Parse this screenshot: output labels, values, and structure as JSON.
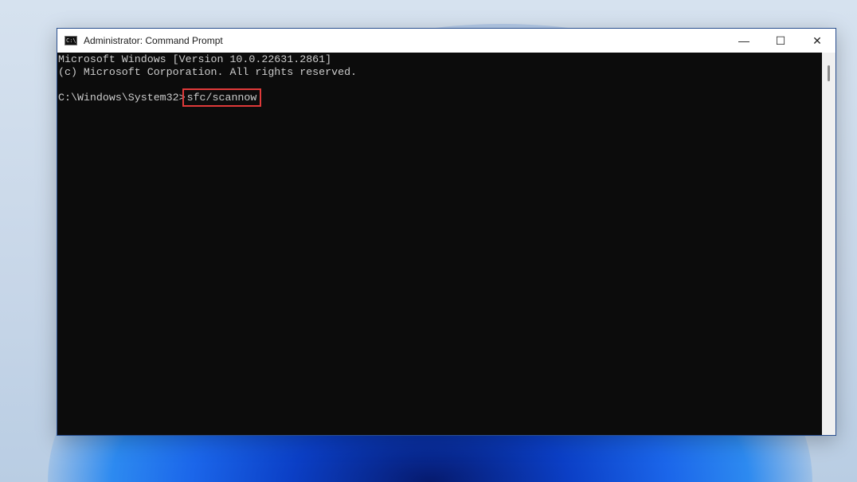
{
  "window": {
    "title": "Administrator: Command Prompt",
    "icon_text": "C:\\."
  },
  "terminal": {
    "lines": [
      "Microsoft Windows [Version 10.0.22631.2861]",
      "(c) Microsoft Corporation. All rights reserved.",
      ""
    ],
    "prompt": "C:\\Windows\\System32>",
    "command": "sfc/scannow"
  },
  "controls": {
    "minimize": "—",
    "maximize": "☐",
    "close": "✕"
  },
  "colors": {
    "highlight": "#e03a3a",
    "terminal_bg": "#0c0c0c"
  }
}
